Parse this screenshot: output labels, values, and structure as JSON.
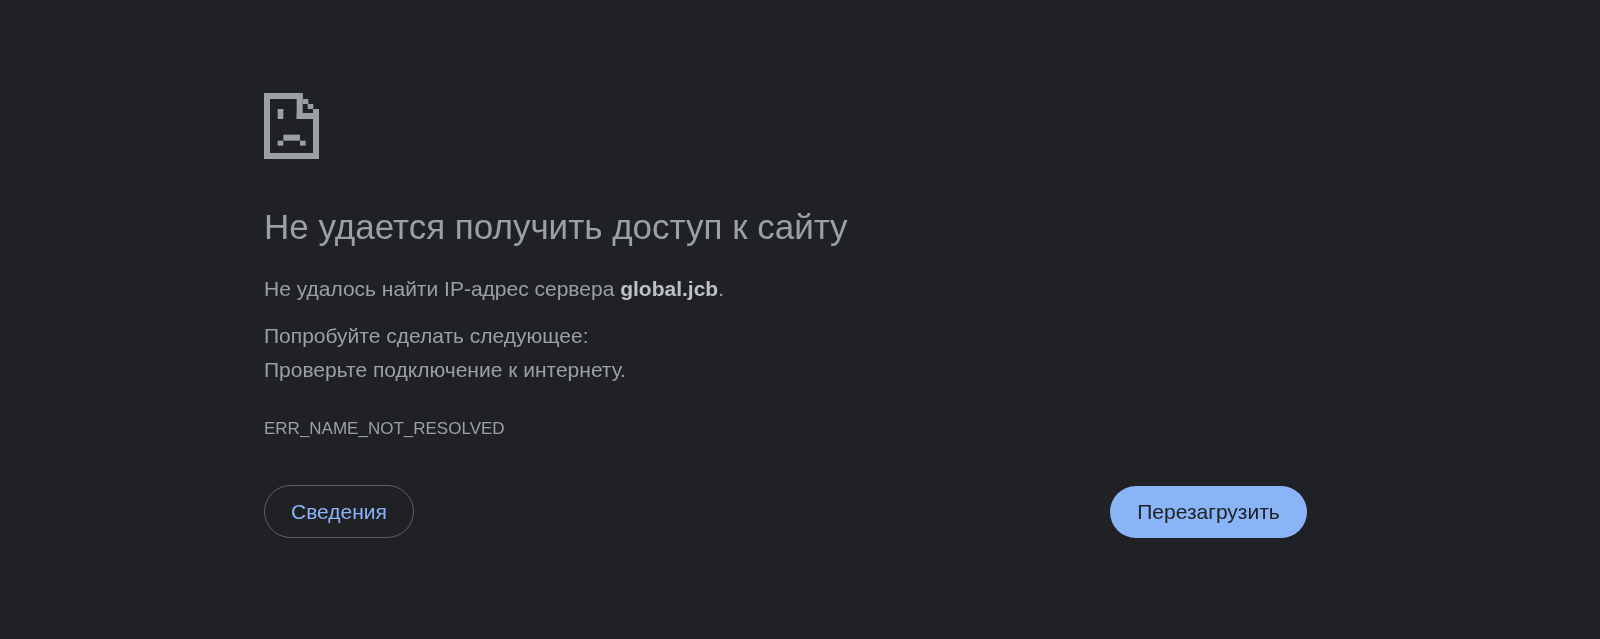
{
  "heading": "Не удается получить доступ к сайту",
  "summary": "Не удалось найти IP-адрес сервера **global.jcb**.",
  "suggestions_title": "Попробуйте сделать следующее:",
  "suggestions": [
    "Проверьте подключение к интернету."
  ],
  "error_code": "ERR_NAME_NOT_RESOLVED",
  "buttons": [
    {
      "label": "Сведения",
      "kind": "secondary"
    },
    {
      "label": "Перезагрузить",
      "kind": "primary"
    }
  ]
}
